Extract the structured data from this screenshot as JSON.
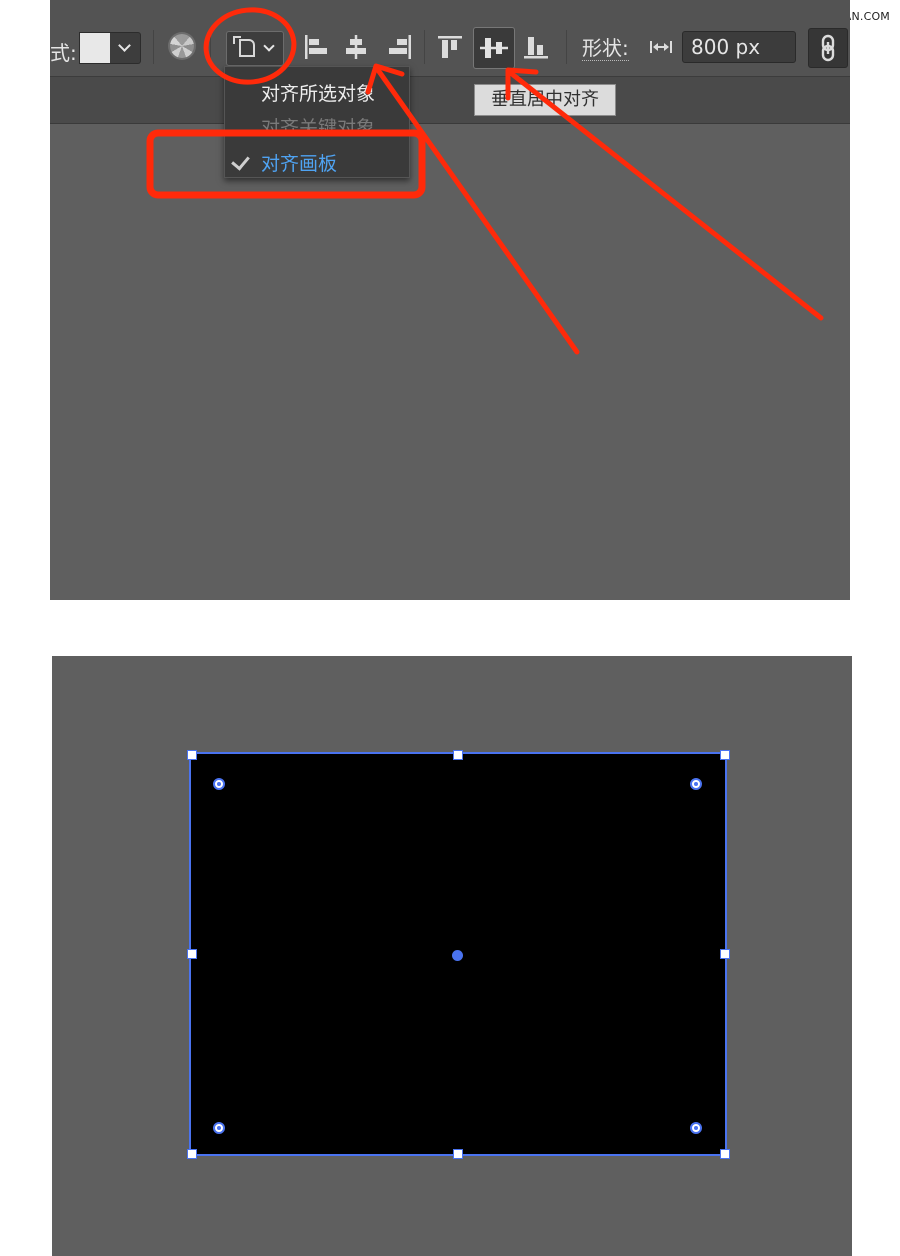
{
  "watermark": "思缘设计论坛 WWW.MISSYUAN.COM",
  "toolbar": {
    "style_label": "式:",
    "style_swatch_color": "#e8e8e8",
    "align_to_icon": "artboard-align-icon",
    "align_icons": [
      "align-left-edges-icon",
      "align-horizontal-centers-icon",
      "align-right-edges-icon",
      "align-top-edges-icon",
      "align-vertical-centers-icon",
      "align-bottom-edges-icon"
    ],
    "shape_label": "形状:",
    "width_value": "800 px",
    "link_icon": "link-icon"
  },
  "dropdown": {
    "items": [
      {
        "label": "对齐所选对象",
        "state": "normal"
      },
      {
        "label": "对齐关键对象",
        "state": "disabled"
      },
      {
        "label": "对齐画板",
        "state": "checked"
      }
    ]
  },
  "tooltip": {
    "text": "垂直居中对齐"
  },
  "annotation_color": "#ff2a0a",
  "selection": {
    "fill": "#000000",
    "outline_color": "#4a73f0"
  }
}
